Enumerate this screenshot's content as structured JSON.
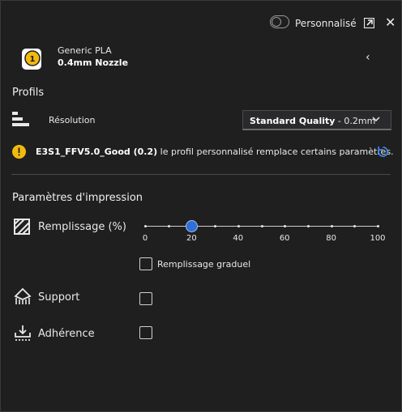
{
  "header": {
    "custom_label": "Personnalisé",
    "custom_enabled": false
  },
  "extruder": {
    "number": "1",
    "material": "Generic PLA",
    "nozzle": "0.4mm Nozzle"
  },
  "profiles": {
    "title": "Profils",
    "resolution_label": "Résolution",
    "quality_bold": "Standard Quality",
    "quality_rest": " - 0.2mm"
  },
  "warning": {
    "profile_name": "E3S1_FFV5.0_Good (0.2)",
    "message": " le profil personnalisé remplace certains paramètres."
  },
  "print_settings": {
    "title": "Paramètres d'impression",
    "infill_label": "Remplissage (%)",
    "infill_value": 20,
    "infill_ticks": [
      "0",
      "20",
      "40",
      "60",
      "80",
      "100"
    ],
    "gradual_label": "Remplissage graduel",
    "gradual_checked": false,
    "support_label": "Support",
    "support_checked": false,
    "adhesion_label": "Adhérence",
    "adhesion_checked": false
  },
  "colors": {
    "accent": "#2f6fd6",
    "warning": "#f2b90f",
    "background": "#1f1f20"
  },
  "icons": [
    "extruder-icon",
    "popout-icon",
    "close-icon",
    "collapse-icon",
    "resolution-icon",
    "warning-icon",
    "reset-icon",
    "infill-icon",
    "support-icon",
    "adhesion-icon",
    "chevron-down-icon"
  ]
}
